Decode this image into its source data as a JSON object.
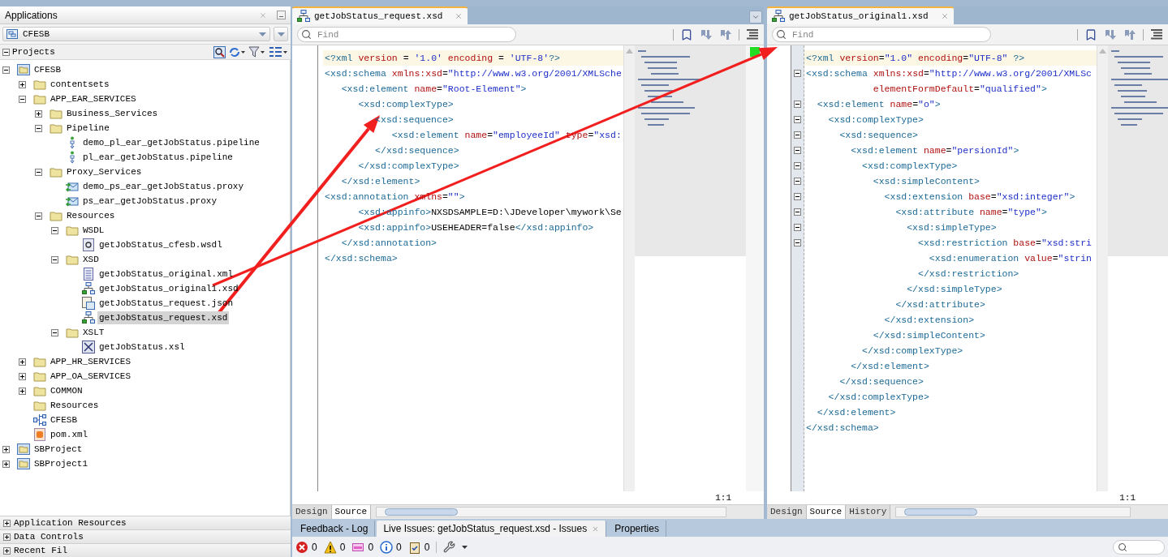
{
  "applications_panel": {
    "title": "Applications",
    "app_selector": {
      "value": "CFESB"
    },
    "projects_header": "Projects"
  },
  "tree": [
    {
      "label": "CFESB",
      "kind": "project",
      "expanded": true,
      "selected": false,
      "children": [
        {
          "label": "contentsets",
          "kind": "folder",
          "expanded": false,
          "selected": false
        },
        {
          "label": "APP_EAR_SERVICES",
          "kind": "folder",
          "expanded": true,
          "selected": false,
          "children": [
            {
              "label": "Business_Services",
              "kind": "folder",
              "expanded": false,
              "selected": false
            },
            {
              "label": "Pipeline",
              "kind": "folder",
              "expanded": true,
              "selected": false,
              "children": [
                {
                  "label": "demo_pl_ear_getJobStatus.pipeline",
                  "kind": "pipeline",
                  "selected": false
                },
                {
                  "label": "pl_ear_getJobStatus.pipeline",
                  "kind": "pipeline",
                  "selected": false
                }
              ]
            },
            {
              "label": "Proxy_Services",
              "kind": "folder",
              "expanded": true,
              "selected": false,
              "children": [
                {
                  "label": "demo_ps_ear_getJobStatus.proxy",
                  "kind": "proxy",
                  "selected": false
                },
                {
                  "label": "ps_ear_getJobStatus.proxy",
                  "kind": "proxy",
                  "selected": false
                }
              ]
            },
            {
              "label": "Resources",
              "kind": "folder",
              "expanded": true,
              "selected": false,
              "children": [
                {
                  "label": "WSDL",
                  "kind": "folder",
                  "expanded": true,
                  "selected": false,
                  "children": [
                    {
                      "label": "getJobStatus_cfesb.wsdl",
                      "kind": "wsdl",
                      "selected": false
                    }
                  ]
                },
                {
                  "label": "XSD",
                  "kind": "folder",
                  "expanded": true,
                  "selected": false,
                  "children": [
                    {
                      "label": "getJobStatus_original.xml",
                      "kind": "xml",
                      "selected": false
                    },
                    {
                      "label": "getJobStatus_original1.xsd",
                      "kind": "xsd",
                      "selected": false
                    },
                    {
                      "label": "getJobStatus_request.json",
                      "kind": "json",
                      "selected": false
                    },
                    {
                      "label": "getJobStatus_request.xsd",
                      "kind": "xsd",
                      "selected": true
                    }
                  ]
                },
                {
                  "label": "XSLT",
                  "kind": "folder",
                  "expanded": true,
                  "selected": false,
                  "children": [
                    {
                      "label": "getJobStatus.xsl",
                      "kind": "xsl",
                      "selected": false
                    }
                  ]
                }
              ]
            }
          ]
        },
        {
          "label": "APP_HR_SERVICES",
          "kind": "folder",
          "expanded": false,
          "selected": false
        },
        {
          "label": "APP_OA_SERVICES",
          "kind": "folder",
          "expanded": false,
          "selected": false
        },
        {
          "label": "COMMON",
          "kind": "folder",
          "expanded": false,
          "selected": false
        },
        {
          "label": "Resources",
          "kind": "folder",
          "selected": false
        },
        {
          "label": "CFESB",
          "kind": "app",
          "selected": false
        },
        {
          "label": "pom.xml",
          "kind": "pom",
          "selected": false
        }
      ]
    },
    {
      "label": "SBProject",
      "kind": "project",
      "expanded": false,
      "selected": false
    },
    {
      "label": "SBProject1",
      "kind": "project",
      "expanded": false,
      "selected": false
    }
  ],
  "accordion": [
    "Application Resources",
    "Data Controls",
    "Recent Fil"
  ],
  "editors": [
    {
      "tab": "getJobStatus_request.xsd",
      "find_placeholder": "Find",
      "position": "1:1",
      "view_tabs": [
        {
          "label": "Design",
          "selected": false
        },
        {
          "label": "Source",
          "selected": true
        }
      ],
      "lines": [
        {
          "current": true,
          "parts": [
            {
              "kind": "tag",
              "text": "<?xml"
            },
            {
              "kind": "attr",
              "text": " version"
            },
            {
              "kind": "text",
              "text": " = "
            },
            {
              "kind": "value",
              "text": "'1.0'"
            },
            {
              "kind": "attr",
              "text": " encoding"
            },
            {
              "kind": "text",
              "text": " = "
            },
            {
              "kind": "value",
              "text": "'UTF-8'"
            },
            {
              "kind": "tag",
              "text": "?>"
            }
          ]
        },
        {
          "current": false,
          "parts": [
            {
              "kind": "tag",
              "text": "<xsd:schema"
            },
            {
              "kind": "attr",
              "text": " xmlns:xsd"
            },
            {
              "kind": "text",
              "text": "="
            },
            {
              "kind": "value",
              "text": "\"http://www.w3.org/2001/XMLSche"
            }
          ]
        },
        {
          "current": false,
          "parts": [
            {
              "kind": "tag",
              "text": "   <xsd:element"
            },
            {
              "kind": "attr",
              "text": " name"
            },
            {
              "kind": "text",
              "text": "="
            },
            {
              "kind": "value",
              "text": "\"Root-Element\""
            },
            {
              "kind": "tag",
              "text": ">"
            }
          ]
        },
        {
          "current": false,
          "parts": [
            {
              "kind": "tag",
              "text": "      <xsd:complexType>"
            }
          ]
        },
        {
          "current": false,
          "parts": [
            {
              "kind": "tag",
              "text": "         <xsd:sequence>"
            }
          ]
        },
        {
          "current": false,
          "parts": [
            {
              "kind": "tag",
              "text": "            <xsd:element"
            },
            {
              "kind": "attr",
              "text": " name"
            },
            {
              "kind": "text",
              "text": "="
            },
            {
              "kind": "value",
              "text": "\"employeeId\""
            },
            {
              "kind": "attr",
              "text": " type"
            },
            {
              "kind": "text",
              "text": "="
            },
            {
              "kind": "value",
              "text": "\"xsd:"
            }
          ]
        },
        {
          "current": false,
          "parts": [
            {
              "kind": "tag",
              "text": "         </xsd:sequence>"
            }
          ]
        },
        {
          "current": false,
          "parts": [
            {
              "kind": "tag",
              "text": "      </xsd:complexType>"
            }
          ]
        },
        {
          "current": false,
          "parts": [
            {
              "kind": "tag",
              "text": "   </xsd:element>"
            }
          ]
        },
        {
          "current": false,
          "parts": [
            {
              "kind": "tag",
              "text": "<xsd:annotation"
            },
            {
              "kind": "attr",
              "text": " xmlns"
            },
            {
              "kind": "text",
              "text": "="
            },
            {
              "kind": "value",
              "text": "\"\""
            },
            {
              "kind": "tag",
              "text": ">"
            }
          ]
        },
        {
          "current": false,
          "parts": [
            {
              "kind": "tag",
              "text": "      <xsd:appinfo>"
            },
            {
              "kind": "text",
              "text": "NXSDSAMPLE=D:\\JDeveloper\\mywork\\Se"
            }
          ]
        },
        {
          "current": false,
          "parts": [
            {
              "kind": "tag",
              "text": "      <xsd:appinfo>"
            },
            {
              "kind": "text",
              "text": "USEHEADER=false"
            },
            {
              "kind": "tag",
              "text": "</xsd:appinfo>"
            }
          ]
        },
        {
          "current": false,
          "parts": [
            {
              "kind": "tag",
              "text": "   </xsd:annotation>"
            }
          ]
        },
        {
          "current": false,
          "parts": [
            {
              "kind": "tag",
              "text": "</xsd:schema>"
            }
          ]
        }
      ]
    },
    {
      "tab": "getJobStatus_original1.xsd",
      "find_placeholder": "Find",
      "position": "1:1",
      "view_tabs": [
        {
          "label": "Design",
          "selected": false
        },
        {
          "label": "Source",
          "selected": true
        },
        {
          "label": "History",
          "selected": false
        }
      ],
      "lines": [
        {
          "current": true,
          "fold": false,
          "parts": [
            {
              "kind": "tag",
              "text": "<?xml"
            },
            {
              "kind": "attr",
              "text": " version"
            },
            {
              "kind": "text",
              "text": "="
            },
            {
              "kind": "value",
              "text": "\"1.0\""
            },
            {
              "kind": "attr",
              "text": " encoding"
            },
            {
              "kind": "text",
              "text": "="
            },
            {
              "kind": "value",
              "text": "\"UTF-8\""
            },
            {
              "kind": "tag",
              "text": " ?>"
            }
          ]
        },
        {
          "current": false,
          "fold": true,
          "parts": [
            {
              "kind": "tag",
              "text": "<xsd:schema"
            },
            {
              "kind": "attr",
              "text": " xmlns:xsd"
            },
            {
              "kind": "text",
              "text": "="
            },
            {
              "kind": "value",
              "text": "\"http://www.w3.org/2001/XMLSc"
            }
          ]
        },
        {
          "current": false,
          "fold": false,
          "parts": [
            {
              "kind": "attr",
              "text": "            elementFormDefault"
            },
            {
              "kind": "text",
              "text": "="
            },
            {
              "kind": "value",
              "text": "\"qualified\""
            },
            {
              "kind": "tag",
              "text": ">"
            }
          ]
        },
        {
          "current": false,
          "fold": true,
          "parts": [
            {
              "kind": "tag",
              "text": "  <xsd:element"
            },
            {
              "kind": "attr",
              "text": " name"
            },
            {
              "kind": "text",
              "text": "="
            },
            {
              "kind": "value",
              "text": "\"o\""
            },
            {
              "kind": "tag",
              "text": ">"
            }
          ]
        },
        {
          "current": false,
          "fold": true,
          "parts": [
            {
              "kind": "tag",
              "text": "    <xsd:complexType>"
            }
          ]
        },
        {
          "current": false,
          "fold": true,
          "parts": [
            {
              "kind": "tag",
              "text": "      <xsd:sequence>"
            }
          ]
        },
        {
          "current": false,
          "fold": true,
          "parts": [
            {
              "kind": "tag",
              "text": "        <xsd:element"
            },
            {
              "kind": "attr",
              "text": " name"
            },
            {
              "kind": "text",
              "text": "="
            },
            {
              "kind": "value",
              "text": "\"persionId\""
            },
            {
              "kind": "tag",
              "text": ">"
            }
          ]
        },
        {
          "current": false,
          "fold": true,
          "parts": [
            {
              "kind": "tag",
              "text": "          <xsd:complexType>"
            }
          ]
        },
        {
          "current": false,
          "fold": true,
          "parts": [
            {
              "kind": "tag",
              "text": "            <xsd:simpleContent>"
            }
          ]
        },
        {
          "current": false,
          "fold": true,
          "parts": [
            {
              "kind": "tag",
              "text": "              <xsd:extension"
            },
            {
              "kind": "attr",
              "text": " base"
            },
            {
              "kind": "text",
              "text": "="
            },
            {
              "kind": "value",
              "text": "\"xsd:integer\""
            },
            {
              "kind": "tag",
              "text": ">"
            }
          ]
        },
        {
          "current": false,
          "fold": true,
          "parts": [
            {
              "kind": "tag",
              "text": "                <xsd:attribute"
            },
            {
              "kind": "attr",
              "text": " name"
            },
            {
              "kind": "text",
              "text": "="
            },
            {
              "kind": "value",
              "text": "\"type\""
            },
            {
              "kind": "tag",
              "text": ">"
            }
          ]
        },
        {
          "current": false,
          "fold": true,
          "parts": [
            {
              "kind": "tag",
              "text": "                  <xsd:simpleType>"
            }
          ]
        },
        {
          "current": false,
          "fold": true,
          "parts": [
            {
              "kind": "tag",
              "text": "                    <xsd:restriction"
            },
            {
              "kind": "attr",
              "text": " base"
            },
            {
              "kind": "text",
              "text": "="
            },
            {
              "kind": "value",
              "text": "\"xsd:stri"
            }
          ]
        },
        {
          "current": false,
          "fold": false,
          "parts": [
            {
              "kind": "tag",
              "text": "                      <xsd:enumeration"
            },
            {
              "kind": "attr",
              "text": " value"
            },
            {
              "kind": "text",
              "text": "="
            },
            {
              "kind": "value",
              "text": "\"strin"
            }
          ]
        },
        {
          "current": false,
          "fold": false,
          "parts": [
            {
              "kind": "tag",
              "text": "                    </xsd:restriction>"
            }
          ]
        },
        {
          "current": false,
          "fold": false,
          "parts": [
            {
              "kind": "tag",
              "text": "                  </xsd:simpleType>"
            }
          ]
        },
        {
          "current": false,
          "fold": false,
          "parts": [
            {
              "kind": "tag",
              "text": "                </xsd:attribute>"
            }
          ]
        },
        {
          "current": false,
          "fold": false,
          "parts": [
            {
              "kind": "tag",
              "text": "              </xsd:extension>"
            }
          ]
        },
        {
          "current": false,
          "fold": false,
          "parts": [
            {
              "kind": "tag",
              "text": "            </xsd:simpleContent>"
            }
          ]
        },
        {
          "current": false,
          "fold": false,
          "parts": [
            {
              "kind": "tag",
              "text": "          </xsd:complexType>"
            }
          ]
        },
        {
          "current": false,
          "fold": false,
          "parts": [
            {
              "kind": "tag",
              "text": "        </xsd:element>"
            }
          ]
        },
        {
          "current": false,
          "fold": false,
          "parts": [
            {
              "kind": "tag",
              "text": "      </xsd:sequence>"
            }
          ]
        },
        {
          "current": false,
          "fold": false,
          "parts": [
            {
              "kind": "tag",
              "text": "    </xsd:complexType>"
            }
          ]
        },
        {
          "current": false,
          "fold": false,
          "parts": [
            {
              "kind": "tag",
              "text": "  </xsd:element>"
            }
          ]
        },
        {
          "current": false,
          "fold": false,
          "parts": [
            {
              "kind": "tag",
              "text": "</xsd:schema>"
            }
          ]
        }
      ]
    }
  ],
  "bottom_panel": {
    "tabs": [
      {
        "label": "Feedback - Log",
        "selected": false
      },
      {
        "label": "Live Issues: getJobStatus_request.xsd - Issues",
        "selected": true
      },
      {
        "label": "Properties",
        "selected": false
      }
    ],
    "counters": [
      {
        "kind": "error",
        "count": "0"
      },
      {
        "kind": "warning",
        "count": "0"
      },
      {
        "kind": "incomplete",
        "count": "0"
      },
      {
        "kind": "info",
        "count": "0"
      },
      {
        "kind": "task",
        "count": "0"
      }
    ]
  }
}
